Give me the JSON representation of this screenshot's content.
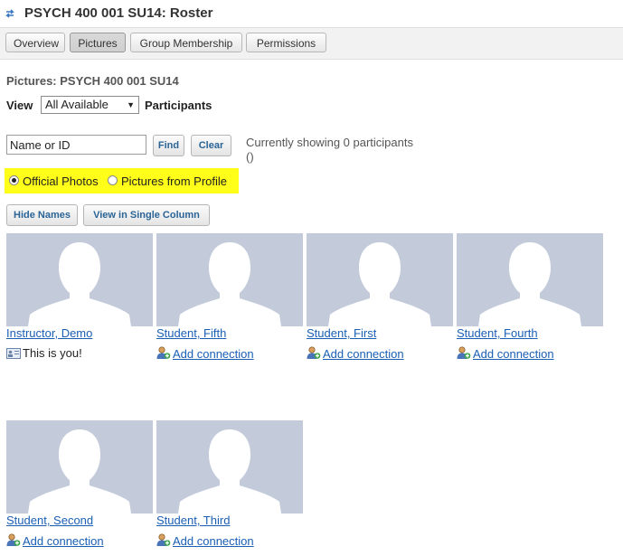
{
  "header": {
    "title": "PSYCH 400 001 SU14: Roster"
  },
  "tabs": [
    {
      "label": "Overview"
    },
    {
      "label": "Pictures",
      "active": true
    },
    {
      "label": "Group Membership"
    },
    {
      "label": "Permissions"
    }
  ],
  "section_title": "Pictures: PSYCH 400 001 SU14",
  "view": {
    "label": "View",
    "selected": "All Available",
    "suffix": "Participants"
  },
  "search": {
    "value": "Name or ID",
    "find_label": "Find",
    "clear_label": "Clear"
  },
  "status": {
    "line1": "Currently showing 0 participants",
    "line2": "()"
  },
  "photo_options": [
    {
      "label": "Official Photos",
      "checked": true
    },
    {
      "label": "Pictures from Profile",
      "checked": false
    }
  ],
  "buttons": {
    "hide_names": "Hide Names",
    "single_column": "View in Single Column"
  },
  "participants": [
    {
      "name": "Instructor, Demo",
      "subtext": "This is you!",
      "sub_icon": "vcard-icon"
    },
    {
      "name": "Student, Fifth",
      "subtext": "Add connection",
      "sub_icon": "add-user-icon"
    },
    {
      "name": "Student, First",
      "subtext": "Add connection",
      "sub_icon": "add-user-icon"
    },
    {
      "name": "Student, Fourth",
      "subtext": "Add connection",
      "sub_icon": "add-user-icon"
    },
    {
      "name": "Student, Second",
      "subtext": "Add connection",
      "sub_icon": "add-user-icon"
    },
    {
      "name": "Student, Third",
      "subtext": "Add connection",
      "sub_icon": "add-user-icon"
    }
  ],
  "colors": {
    "highlight": "#ffff1a",
    "photo_bg": "#c3cbdb",
    "link": "#1a5fb4"
  }
}
